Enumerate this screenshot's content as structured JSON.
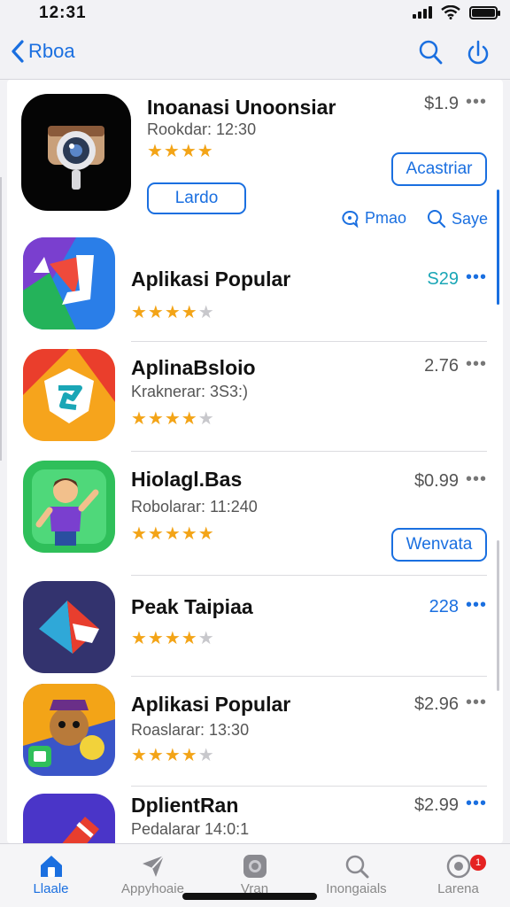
{
  "status": {
    "time": "12:31"
  },
  "nav": {
    "back_label": "Rboa"
  },
  "apps": [
    {
      "name": "Inoanasi Unoonsiar",
      "subtitle": "Rookdar: 12:30",
      "stars": 4,
      "price": "$1.9",
      "button": "Acastriar",
      "secondary_button": "Lardo",
      "link_1": "Pmao",
      "link_2": "Saye"
    },
    {
      "name": "Aplikasi Popular",
      "subtitle": "",
      "stars": 4,
      "price": "S29"
    },
    {
      "name": "AplinaBsloio",
      "subtitle": "Kraknerar: 3S3:)",
      "stars": 4,
      "price": "2.76"
    },
    {
      "name": "Hiolagl.Bas",
      "subtitle": "Robolarar: 11:240",
      "stars": 5,
      "price": "$0.99",
      "button": "Wenvata"
    },
    {
      "name": "Peak Taipiaa",
      "subtitle": "",
      "stars": 4,
      "price": "228"
    },
    {
      "name": "Aplikasi Popular",
      "subtitle": "Roaslarar: 13:30",
      "stars": 4,
      "price": "$2.96"
    },
    {
      "name": "DplientRan",
      "subtitle": "Pedalarar 14:0:1",
      "stars": 0,
      "price": "$2.99"
    }
  ],
  "tabs": [
    {
      "label": "Llaale",
      "icon": "home-icon",
      "active": true
    },
    {
      "label": "Appyhoaie",
      "icon": "paper-plane-icon",
      "active": false
    },
    {
      "label": "Vran",
      "icon": "camera-icon",
      "active": false
    },
    {
      "label": "Inongaials",
      "icon": "search-icon",
      "active": false
    },
    {
      "label": "Larena",
      "icon": "account-icon",
      "active": false,
      "badge": "1"
    }
  ],
  "colors": {
    "accent": "#1a6fe0",
    "star": "#f3a417",
    "badge": "#e52222"
  }
}
